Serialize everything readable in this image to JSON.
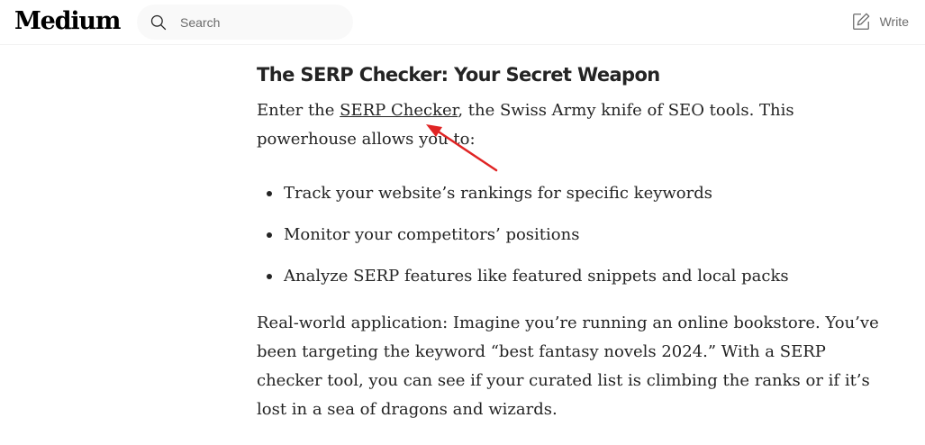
{
  "header": {
    "logo": "Medium",
    "search_placeholder": "Search",
    "write_label": "Write"
  },
  "article": {
    "heading": "The SERP Checker: Your Secret Weapon",
    "intro_before_link": "Enter the ",
    "intro_link": "SERP Checker",
    "intro_after_link": ", the Swiss Army knife of SEO tools. This powerhouse allows you to:",
    "bullets": [
      "Track your website’s rankings for specific keywords",
      "Monitor your competitors’ positions",
      "Analyze SERP features like featured snippets and local packs"
    ],
    "paragraph": "Real-world application: Imagine you’re running an online bookstore. You’ve been targeting the keyword “best fantasy novels 2024.” With a SERP checker tool, you can see if your curated list is climbing the ranks or if it’s lost in a sea of dragons and wizards."
  },
  "annotation": {
    "arrow_color": "#e02424"
  }
}
